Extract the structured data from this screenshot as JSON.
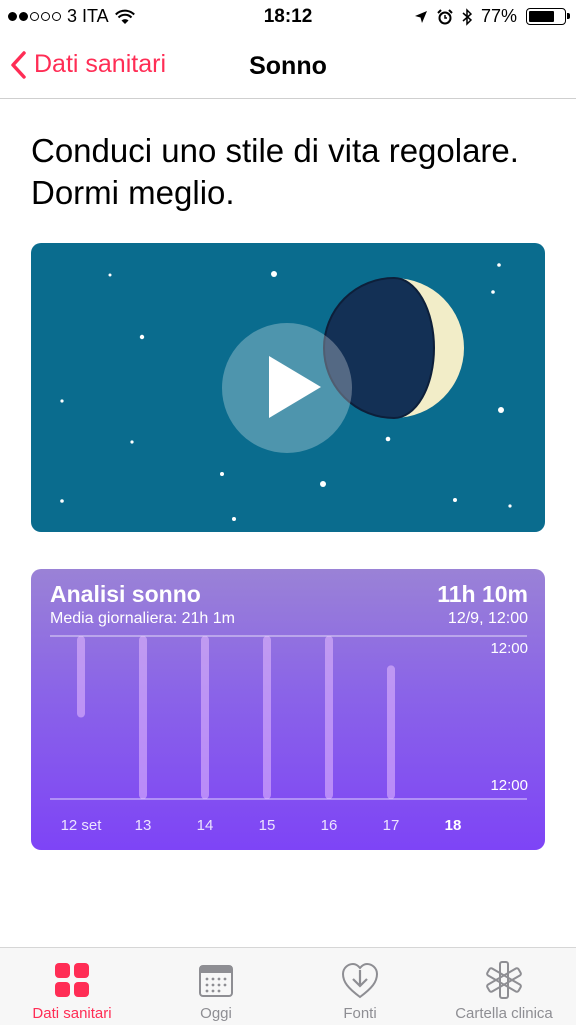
{
  "status_bar": {
    "carrier": "3 ITA",
    "time": "18:12",
    "battery": "77%",
    "battery_level": 0.77
  },
  "nav": {
    "back_label": "Dati sanitari",
    "title": "Sonno"
  },
  "headline": {
    "line1": "Conduci uno stile di vita regolare.",
    "line2": "Dormi meglio."
  },
  "sleep_card": {
    "title": "Analisi sonno",
    "subtitle": "Media giornaliera: 21h 1m",
    "value": "11h 10m",
    "date": "12/9, 12:00",
    "axis_top": "12:00",
    "axis_bottom": "12:00"
  },
  "chart_data": {
    "type": "bar",
    "categories": [
      "12 set",
      "13",
      "14",
      "15",
      "16",
      "17",
      "18"
    ],
    "series": [
      {
        "start": [
          0.5,
          0.0,
          0.0,
          0.0,
          0.0,
          0.0,
          null
        ],
        "end": [
          1.0,
          1.0,
          1.0,
          1.0,
          1.0,
          0.82,
          null
        ]
      }
    ],
    "highlight_category": "18"
  },
  "tabs": [
    {
      "label": "Dati sanitari",
      "icon": "dashboard-grid-icon",
      "active": true
    },
    {
      "label": "Oggi",
      "icon": "calendar-icon",
      "active": false
    },
    {
      "label": "Fonti",
      "icon": "download-heart-icon",
      "active": false
    },
    {
      "label": "Cartella clinica",
      "icon": "medical-star-icon",
      "active": false
    }
  ],
  "colors": {
    "accent": "#ff2d55",
    "video_bg": "#0a6c8e",
    "moon_dark": "#133055",
    "moon_light": "#f2edc8",
    "chart_top": "#9a82d6",
    "chart_bottom": "#7e44f6"
  }
}
